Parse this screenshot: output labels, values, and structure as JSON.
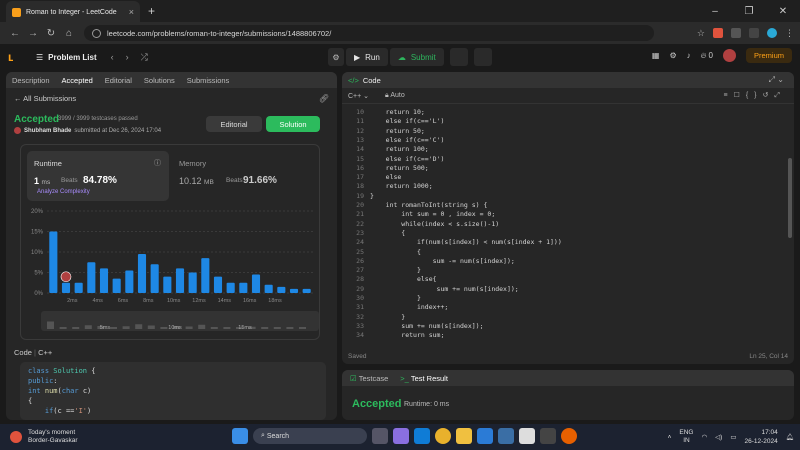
{
  "browser": {
    "tab_title": "Roman to Integer - LeetCode",
    "url": "leetcode.com/problems/roman-to-integer/submissions/1488806702/"
  },
  "topbar": {
    "problem_list": "Problem List",
    "run": "Run",
    "submit": "Submit",
    "fire_count": "0",
    "premium": "Premium"
  },
  "left_tabs": [
    "Description",
    "Accepted",
    "Editorial",
    "Solutions",
    "Submissions"
  ],
  "submission": {
    "back": "All Submissions",
    "status": "Accepted",
    "testcases": "3999 / 3999 testcases passed",
    "user": "Shubham Bhade",
    "submitted": "submitted at Dec 26, 2024 17:04",
    "editorial_btn": "Editorial",
    "solution_btn": "Solution"
  },
  "stats": {
    "runtime_label": "Runtime",
    "runtime_value": "1",
    "runtime_unit": "ms",
    "beats_label": "Beats",
    "runtime_pct": "84.78%",
    "analyze": "Analyze Complexity",
    "memory_label": "Memory",
    "memory_value": "10.12",
    "memory_unit": "MB",
    "memory_pct": "91.66%"
  },
  "chart_data": {
    "type": "bar",
    "ylim": [
      0,
      20
    ],
    "yticks": [
      "20%",
      "15%",
      "10%",
      "5%",
      "0%"
    ],
    "xticks": [
      "2ms",
      "4ms",
      "6ms",
      "8ms",
      "10ms",
      "12ms",
      "14ms",
      "16ms",
      "18ms"
    ],
    "values": [
      15,
      2.5,
      2.5,
      7.5,
      6,
      3.5,
      5.5,
      9.5,
      7,
      4,
      6,
      5,
      8.5,
      4,
      2.5,
      2.5,
      4.5,
      2,
      1.5,
      1,
      1
    ],
    "highlight_index": 1,
    "minimap_labels": [
      "5ms",
      "10ms",
      "15ms"
    ]
  },
  "code_panel": {
    "lang_label": "Code",
    "lang": "C++",
    "lines": [
      "class Solution {",
      "public:",
      "int num(char c)",
      "{",
      "    if(c =='I')"
    ]
  },
  "editor": {
    "title": "Code",
    "lang": "C++",
    "mode": "Auto",
    "start_line": 10,
    "lines": [
      "    return 10;",
      "    else if(c=='L')",
      "    return 50;",
      "    else if(c=='C')",
      "    return 100;",
      "    else if(c=='D')",
      "    return 500;",
      "    else",
      "    return 1000;",
      "}",
      "    int romanToInt(string s) {",
      "        int sum = 0 , index = 0;",
      "        while(index < s.size()-1)",
      "        {",
      "            if(num(s[index]) < num(s[index + 1]))",
      "            {",
      "                sum -= num(s[index]);",
      "            }",
      "            else{",
      "                 sum += num(s[index]);",
      "            }",
      "            index++;",
      "        }",
      "        sum += num(s[index]);",
      "        return sum;"
    ],
    "saved": "Saved",
    "cursor": "Ln 25, Col 14"
  },
  "result": {
    "tab_testcase": "Testcase",
    "tab_result": "Test Result",
    "status": "Accepted",
    "runtime": "Runtime: 0 ms"
  },
  "taskbar": {
    "weather_title": "Today's moment",
    "weather_sub": "Border-Gavaskar",
    "search": "Search",
    "lang1": "ENG",
    "lang2": "IN",
    "time": "17:04",
    "date": "26-12-2024"
  }
}
